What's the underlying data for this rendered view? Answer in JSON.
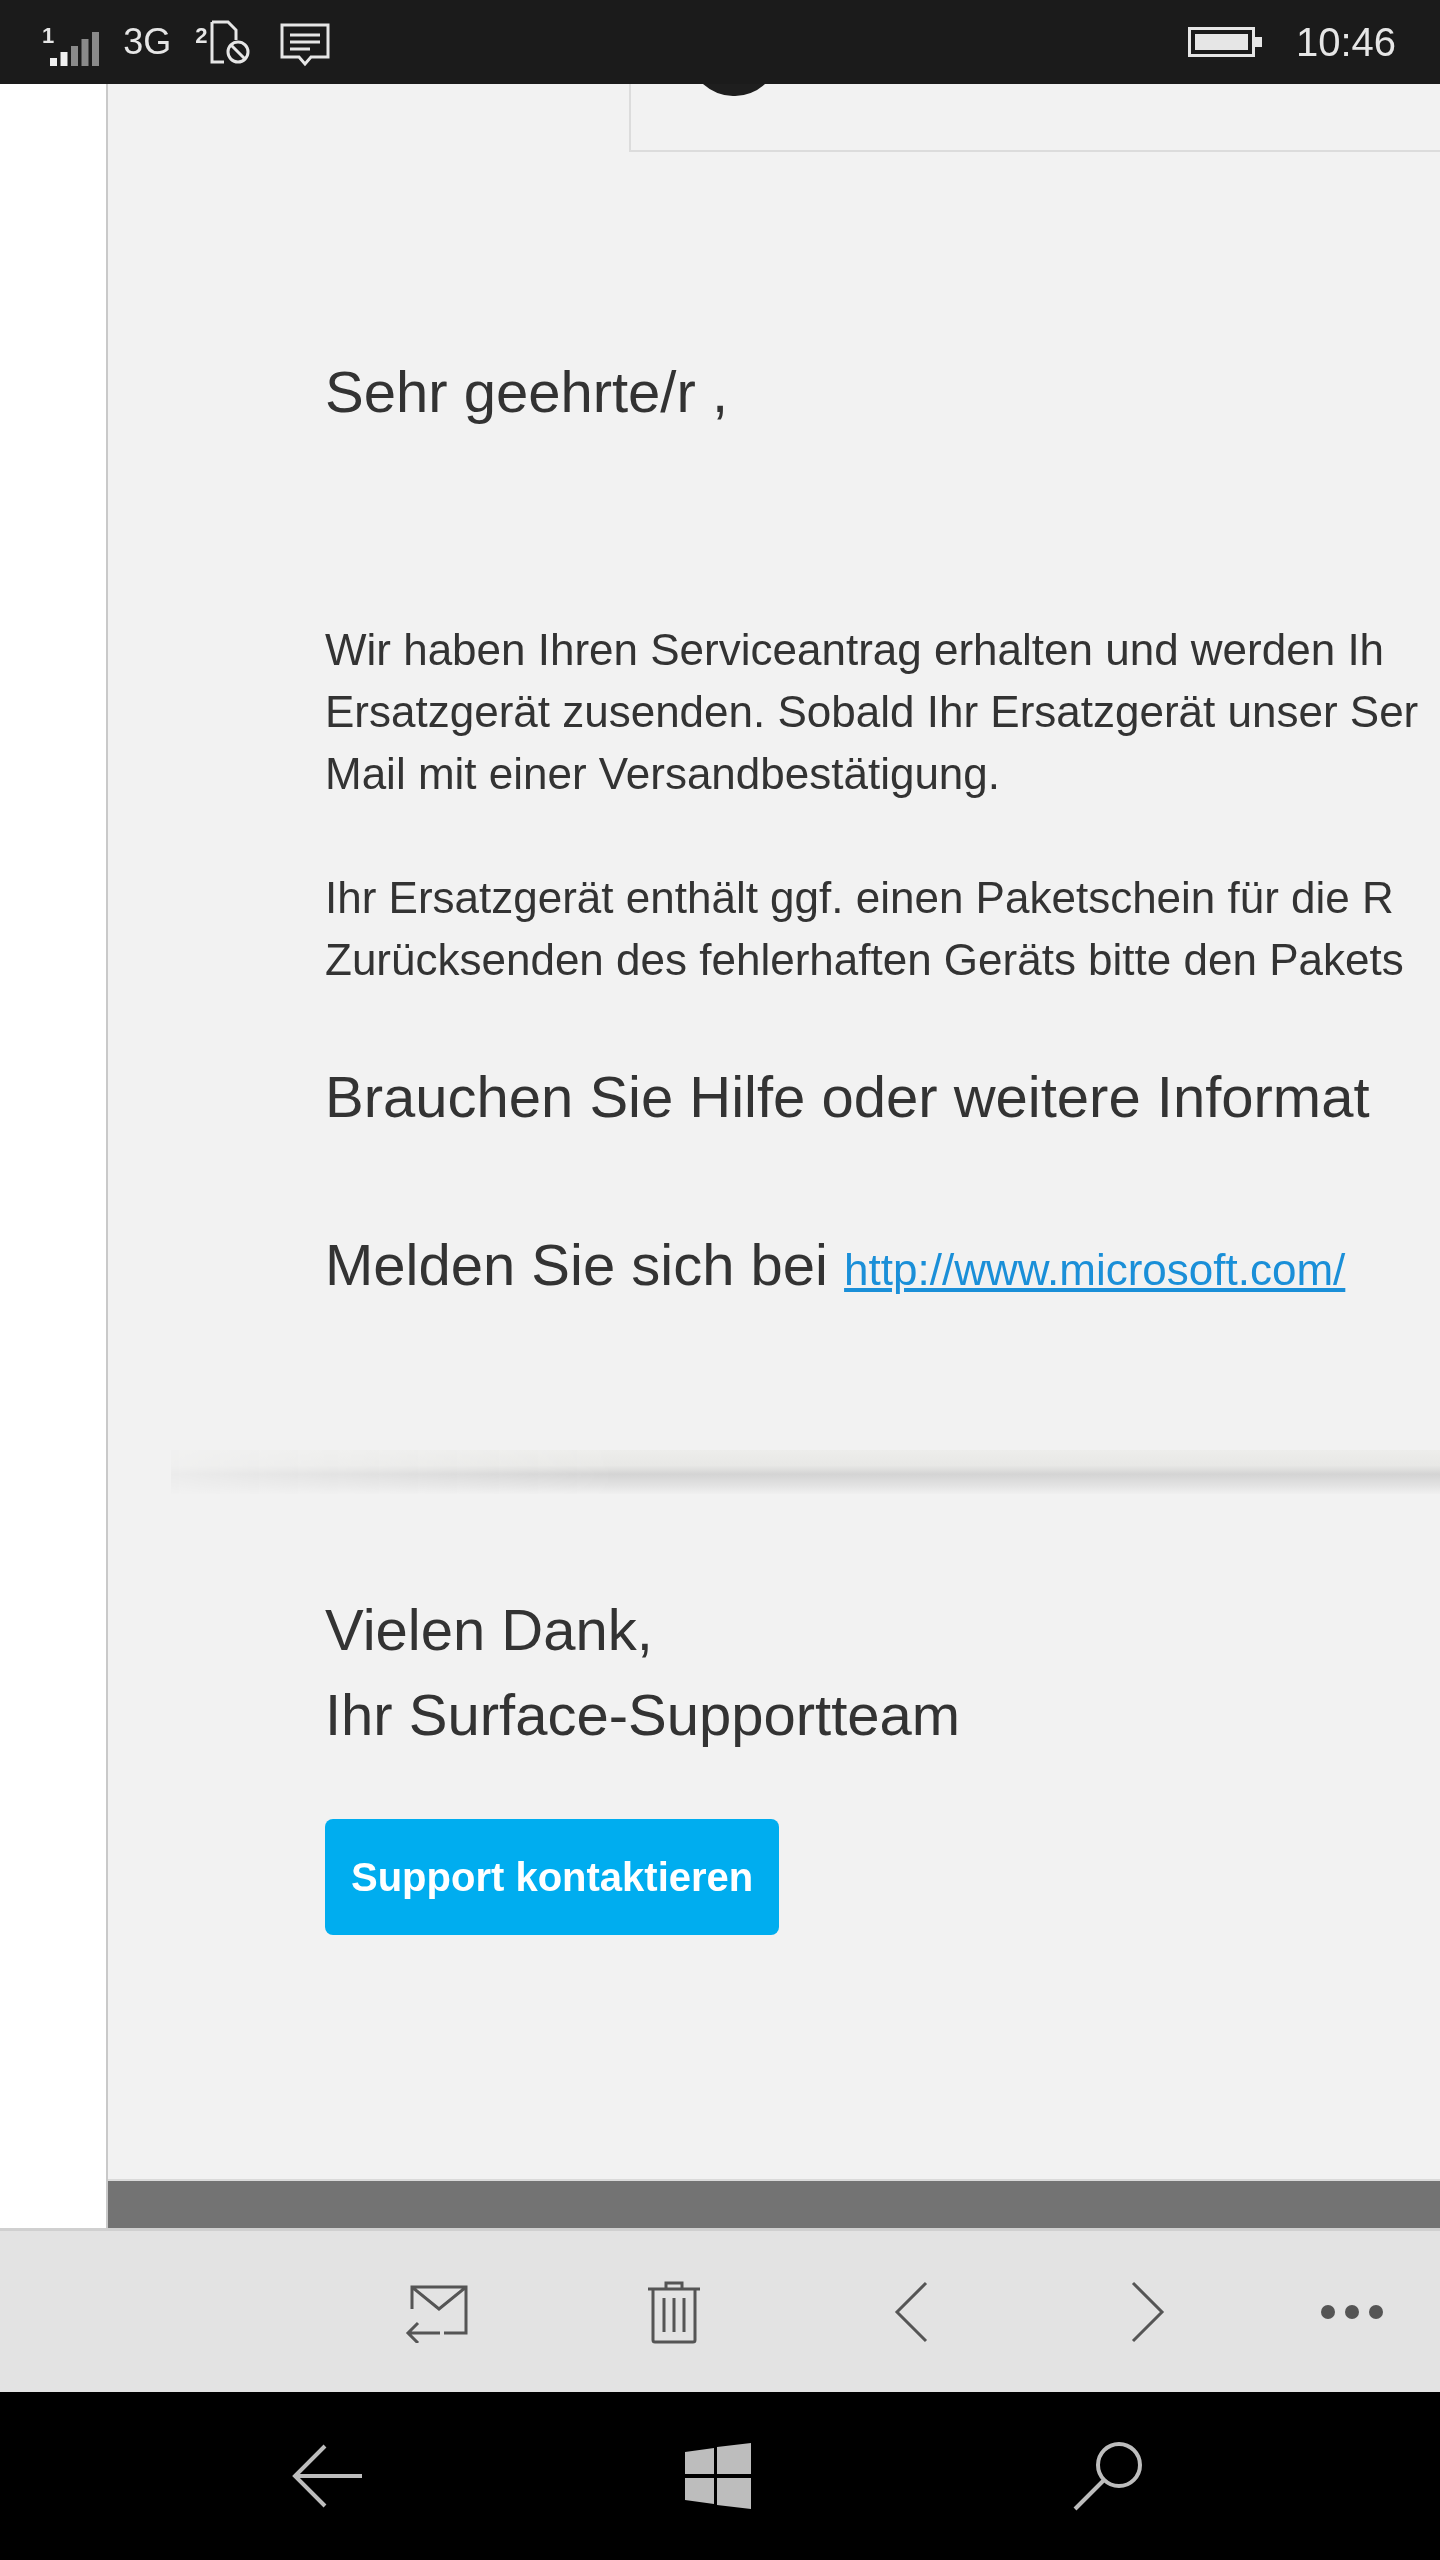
{
  "status_bar": {
    "sim_1_label": "1",
    "network": "3G",
    "sim_2_label": "2",
    "time": "10:46"
  },
  "email": {
    "greeting": "Sehr geehrte/r ,",
    "paragraphs": [
      {
        "lines": [
          "Wir haben Ihren Serviceantrag erhalten und werden Ih",
          "Ersatzgerät zusenden. Sobald Ihr Ersatzgerät unser Ser",
          "Mail mit einer Versandbestätigung."
        ]
      },
      {
        "lines": [
          "Ihr Ersatzgerät enthält ggf. einen Paketschein für die R",
          "Zurücksenden des fehlerhaften Geräts bitte den Pakets"
        ]
      }
    ],
    "help_heading": "Brauchen Sie Hilfe oder weitere Informat",
    "login_text": "Melden Sie sich bei",
    "login_link": "http://www.microsoft.com/",
    "closing": "Vielen Dank,",
    "signature": "Ihr Surface-Supportteam",
    "contact_button": "Support kontaktieren"
  }
}
